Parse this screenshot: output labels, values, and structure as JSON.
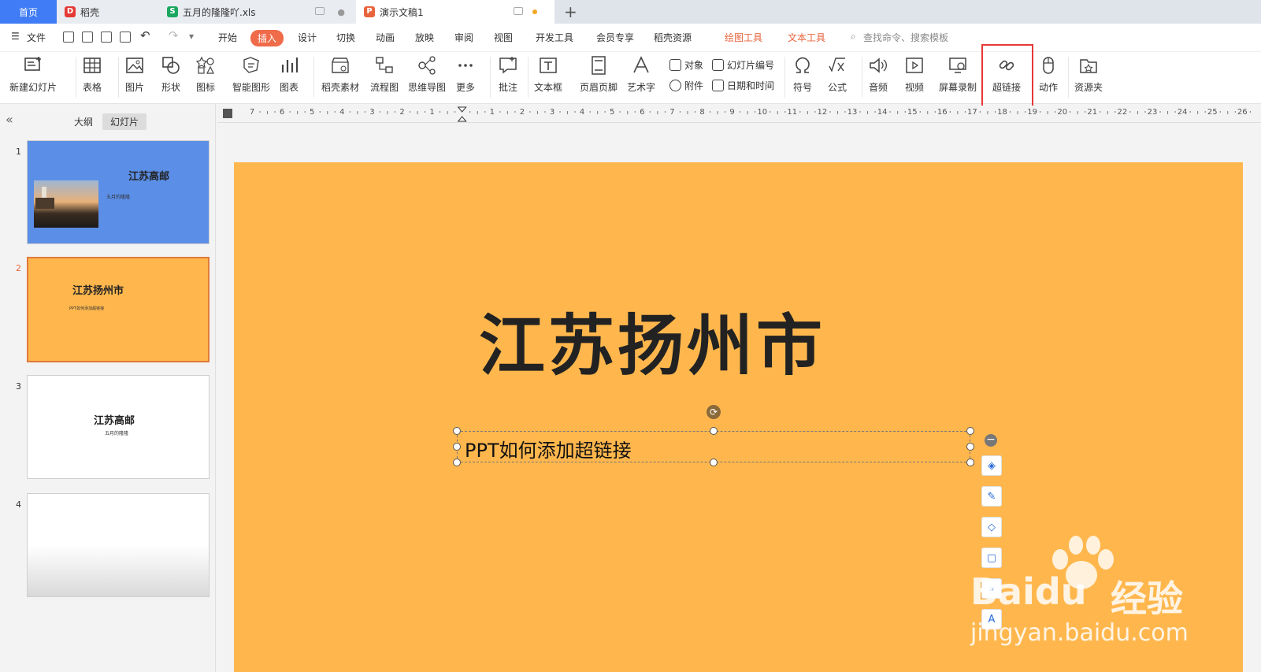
{
  "tabs": [
    {
      "label": "首页"
    },
    {
      "label": "稻壳"
    },
    {
      "label": "五月的隆隆吖.xls"
    },
    {
      "label": "演示文稿1"
    }
  ],
  "menu": {
    "file": "文件",
    "items": [
      "开始",
      "插入",
      "设计",
      "切换",
      "动画",
      "放映",
      "审阅",
      "视图",
      "开发工具",
      "会员专享",
      "稻壳资源"
    ],
    "active": "插入",
    "drawing_tools": "绘图工具",
    "text_tools": "文本工具",
    "search_placeholder": "查找命令、搜索模板"
  },
  "ribbon": {
    "new_slide": "新建幻灯片",
    "table": "表格",
    "picture": "图片",
    "shape": "形状",
    "icon": "图标",
    "smartart": "智能图形",
    "chart": "图表",
    "daoke_material": "稻壳素材",
    "flowchart": "流程图",
    "mindmap": "思维导图",
    "more": "更多",
    "comment": "批注",
    "textbox": "文本框",
    "header_footer": "页眉页脚",
    "wordart": "艺术字",
    "object": "对象",
    "attachment": "附件",
    "slide_number": "幻灯片编号",
    "datetime": "日期和时间",
    "symbol": "符号",
    "formula": "公式",
    "audio": "音频",
    "video": "视频",
    "screen_record": "屏幕录制",
    "hyperlink": "超链接",
    "action": "动作",
    "resource": "资源夹"
  },
  "panel": {
    "outline_tab": "大纲",
    "slides_tab": "幻灯片",
    "slides": [
      {
        "num": "1",
        "title": "江苏高邮",
        "subtitle": "五月的隆隆"
      },
      {
        "num": "2",
        "title": "江苏扬州市",
        "subtitle": "PPT如何添加超链接"
      },
      {
        "num": "3",
        "title": "江苏高邮",
        "subtitle": "五月的隆隆"
      },
      {
        "num": "4",
        "title": "",
        "subtitle": ""
      }
    ]
  },
  "ruler": {
    "labels": [
      "7",
      "6",
      "5",
      "4",
      "3",
      "2",
      "1",
      "",
      "1",
      "2",
      "3",
      "4",
      "5",
      "6",
      "7",
      "8",
      "9",
      "10",
      "11",
      "12",
      "13",
      "14",
      "15",
      "16",
      "17",
      "18",
      "19",
      "20",
      "21",
      "22",
      "23",
      "24",
      "25",
      "26"
    ]
  },
  "slide": {
    "title": "江苏扬州市",
    "subtitle": "PPT如何添加超链接"
  },
  "watermark": {
    "brand": "Baidu",
    "cn": "经验",
    "url": "jingyan.baidu.com"
  },
  "colors": {
    "accent": "#ef6b4a",
    "slide_bg": "#ffb74d",
    "slide1_bg": "#5b8ee6",
    "highlight": "#e53935"
  }
}
